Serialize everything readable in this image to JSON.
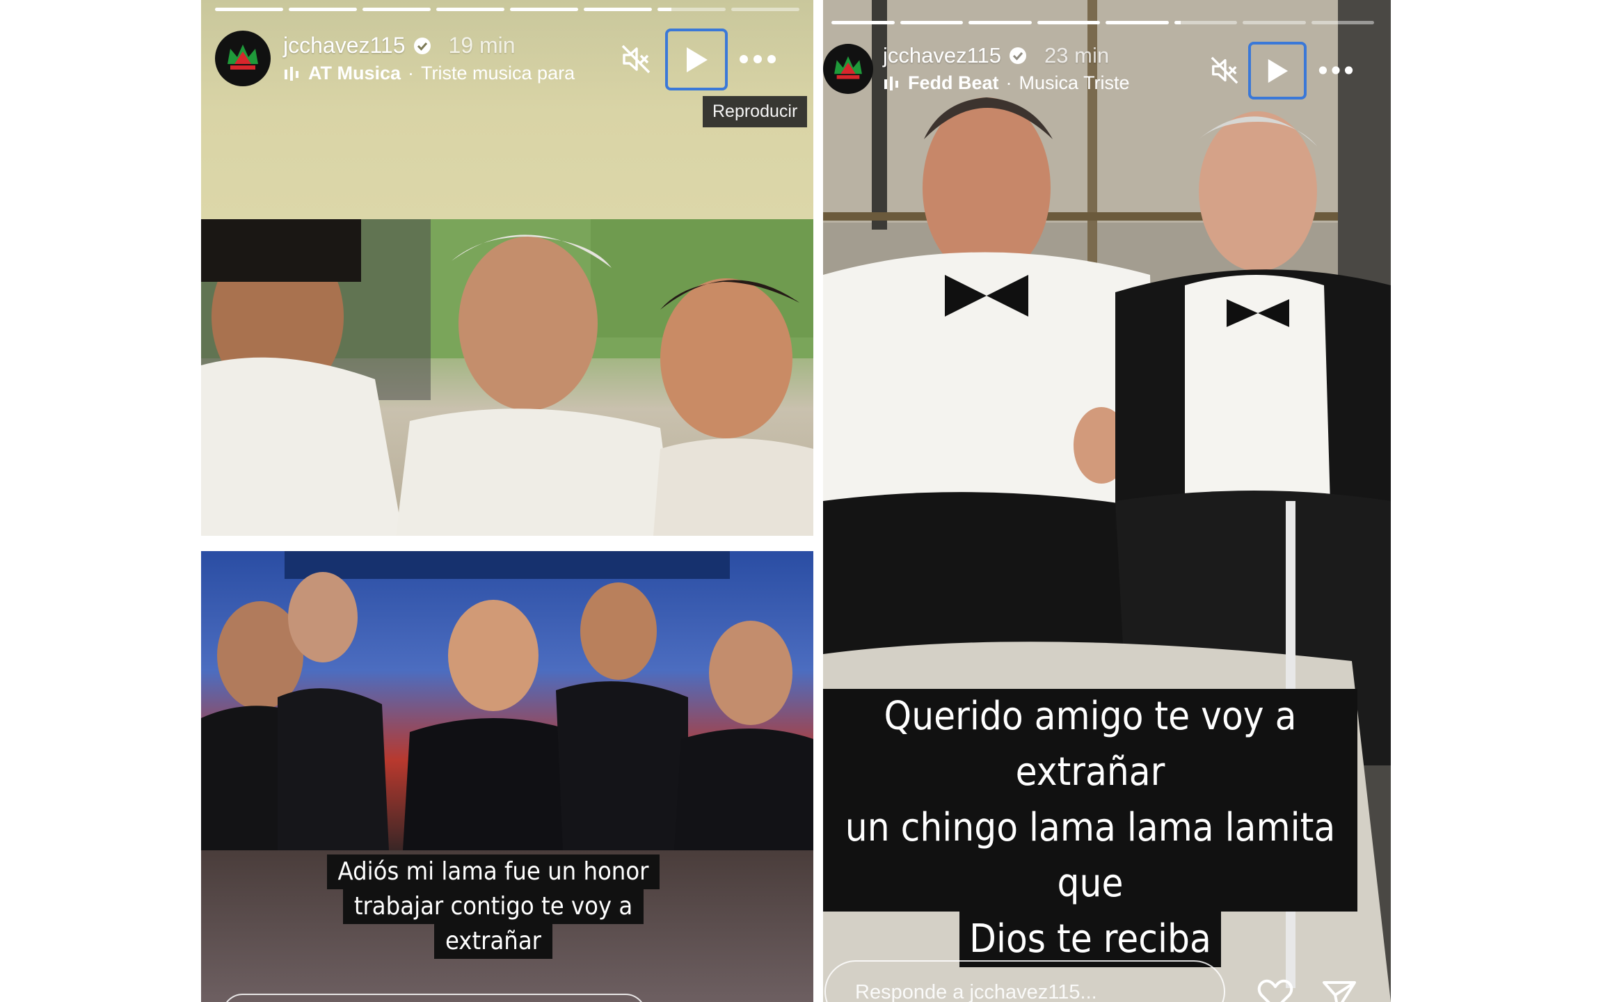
{
  "stories": [
    {
      "username": "jcchavez115",
      "time": "19 min",
      "music_artist": "AT Musica",
      "music_title": "Triste musica para",
      "tooltip": "Reproducir",
      "progress": [
        1,
        1,
        1,
        1,
        1,
        1,
        0.2,
        0
      ],
      "caption_lines": [
        "Adiós mi lama fue un honor",
        "trabajar contigo te voy a",
        "extrañar"
      ]
    },
    {
      "username": "jcchavez115",
      "time": "23 min",
      "music_artist": "Fedd Beat",
      "music_title": "Musica Triste",
      "progress": [
        1,
        1,
        1,
        1,
        1,
        0.1,
        0,
        0
      ],
      "caption_lines": [
        "Querido amigo te voy a extrañar",
        "un chingo lama lama lamita que",
        "Dios te reciba"
      ],
      "reply_placeholder": "Responde a jcchavez115..."
    }
  ],
  "icons": {
    "verified": "verified-badge-icon",
    "music": "music-bars-icon",
    "mute": "speaker-muted-icon",
    "play": "play-icon",
    "more": "more-dots-icon",
    "like": "heart-icon",
    "share": "paper-plane-icon"
  },
  "colors": {
    "play_focus_border": "#3a78d8",
    "avatar_bg": "#111111",
    "caption_bg": "#111111"
  }
}
